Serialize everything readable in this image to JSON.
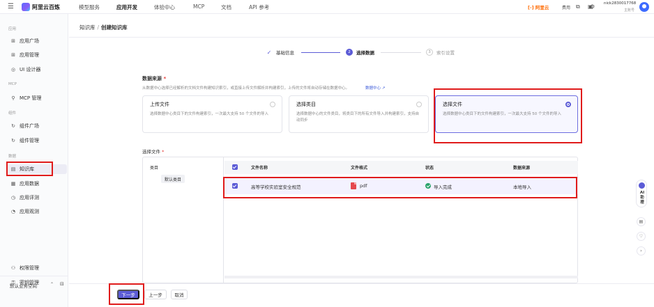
{
  "topbar": {
    "logo": "阿里云百炼",
    "nav": [
      "模型服务",
      "应用开发",
      "体验中心",
      "MCP",
      "文档",
      "API 参考"
    ],
    "active_nav": "应用开发",
    "brand": "[-] 阿里云",
    "fee_label": "费用",
    "user_name": "nick2830017768",
    "user_role": "主账号"
  },
  "sidebar": {
    "sections": {
      "apps": "应用",
      "mcp": "MCP",
      "components": "组件",
      "data": "数据"
    },
    "items": {
      "app_plaza": "应用广场",
      "app_manage": "应用管理",
      "ui_designer": "UI 设计器",
      "mcp_manage": "MCP 管理",
      "comp_plaza": "组件广场",
      "comp_manage": "组件管理",
      "knowledge": "知识库",
      "app_data": "应用数据",
      "app_eval": "应用评测",
      "app_observe": "应用观测",
      "permission": "权限管理",
      "key_manage": "密钥管理"
    },
    "workspace": "默认业务空间"
  },
  "breadcrumb": {
    "parent": "知识库",
    "current": "创建知识库"
  },
  "steps": [
    {
      "label": "基础信息",
      "num": "✓",
      "state": "done"
    },
    {
      "label": "选择数据",
      "num": "2",
      "state": "active"
    },
    {
      "label": "索引设置",
      "num": "3",
      "state": "todo"
    }
  ],
  "data_source": {
    "title": "数据来源",
    "required": "*",
    "desc": "从数据中心选择已经解析的文档文件构建知识索引，或直接上传文件解析并构建索引，上传的文件将自动存储在数据中心。",
    "link": "数据中心 ↗",
    "cards": [
      {
        "title": "上传文件",
        "desc": "选择数据中心类目下的文件构建索引，一次最大支持 50 个文件的导入"
      },
      {
        "title": "选择类目",
        "desc": "选择数据中心的文件类目，将类目下的所有文件导入并构建索引，支持自动同步"
      },
      {
        "title": "选择文件",
        "desc": "选择数据中心类目下的文件构建索引，一次最大支持 50 个文件的导入"
      }
    ],
    "selected": "选择文件"
  },
  "file_select": {
    "title": "选择文件",
    "required": "*",
    "category_label": "类目",
    "category_item": "默认类目",
    "columns": {
      "name": "文件名称",
      "format": "文件格式",
      "status": "状态",
      "source": "数据来源"
    },
    "rows": [
      {
        "name": "高等学校实验室安全规范",
        "format": "pdf",
        "status": "导入完成",
        "source": "本地导入",
        "checked": true
      }
    ]
  },
  "footer": {
    "next": "下一步",
    "prev": "上一步",
    "cancel": "取消"
  },
  "right_tools": {
    "ai_label": "AI 助理"
  },
  "colors": {
    "accent": "#5b5bd6",
    "annotation": "#e01b1b",
    "success": "#2aa36b",
    "pdf": "#e5484d"
  }
}
